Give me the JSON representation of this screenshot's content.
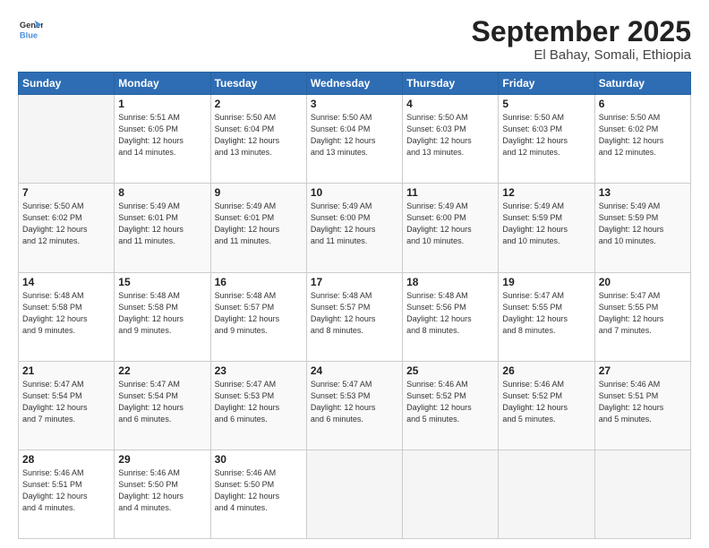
{
  "header": {
    "logo_line1": "General",
    "logo_line2": "Blue",
    "month": "September 2025",
    "location": "El Bahay, Somali, Ethiopia"
  },
  "weekdays": [
    "Sunday",
    "Monday",
    "Tuesday",
    "Wednesday",
    "Thursday",
    "Friday",
    "Saturday"
  ],
  "weeks": [
    [
      {
        "day": "",
        "info": ""
      },
      {
        "day": "1",
        "info": "Sunrise: 5:51 AM\nSunset: 6:05 PM\nDaylight: 12 hours\nand 14 minutes."
      },
      {
        "day": "2",
        "info": "Sunrise: 5:50 AM\nSunset: 6:04 PM\nDaylight: 12 hours\nand 13 minutes."
      },
      {
        "day": "3",
        "info": "Sunrise: 5:50 AM\nSunset: 6:04 PM\nDaylight: 12 hours\nand 13 minutes."
      },
      {
        "day": "4",
        "info": "Sunrise: 5:50 AM\nSunset: 6:03 PM\nDaylight: 12 hours\nand 13 minutes."
      },
      {
        "day": "5",
        "info": "Sunrise: 5:50 AM\nSunset: 6:03 PM\nDaylight: 12 hours\nand 12 minutes."
      },
      {
        "day": "6",
        "info": "Sunrise: 5:50 AM\nSunset: 6:02 PM\nDaylight: 12 hours\nand 12 minutes."
      }
    ],
    [
      {
        "day": "7",
        "info": "Sunrise: 5:50 AM\nSunset: 6:02 PM\nDaylight: 12 hours\nand 12 minutes."
      },
      {
        "day": "8",
        "info": "Sunrise: 5:49 AM\nSunset: 6:01 PM\nDaylight: 12 hours\nand 11 minutes."
      },
      {
        "day": "9",
        "info": "Sunrise: 5:49 AM\nSunset: 6:01 PM\nDaylight: 12 hours\nand 11 minutes."
      },
      {
        "day": "10",
        "info": "Sunrise: 5:49 AM\nSunset: 6:00 PM\nDaylight: 12 hours\nand 11 minutes."
      },
      {
        "day": "11",
        "info": "Sunrise: 5:49 AM\nSunset: 6:00 PM\nDaylight: 12 hours\nand 10 minutes."
      },
      {
        "day": "12",
        "info": "Sunrise: 5:49 AM\nSunset: 5:59 PM\nDaylight: 12 hours\nand 10 minutes."
      },
      {
        "day": "13",
        "info": "Sunrise: 5:49 AM\nSunset: 5:59 PM\nDaylight: 12 hours\nand 10 minutes."
      }
    ],
    [
      {
        "day": "14",
        "info": "Sunrise: 5:48 AM\nSunset: 5:58 PM\nDaylight: 12 hours\nand 9 minutes."
      },
      {
        "day": "15",
        "info": "Sunrise: 5:48 AM\nSunset: 5:58 PM\nDaylight: 12 hours\nand 9 minutes."
      },
      {
        "day": "16",
        "info": "Sunrise: 5:48 AM\nSunset: 5:57 PM\nDaylight: 12 hours\nand 9 minutes."
      },
      {
        "day": "17",
        "info": "Sunrise: 5:48 AM\nSunset: 5:57 PM\nDaylight: 12 hours\nand 8 minutes."
      },
      {
        "day": "18",
        "info": "Sunrise: 5:48 AM\nSunset: 5:56 PM\nDaylight: 12 hours\nand 8 minutes."
      },
      {
        "day": "19",
        "info": "Sunrise: 5:47 AM\nSunset: 5:55 PM\nDaylight: 12 hours\nand 8 minutes."
      },
      {
        "day": "20",
        "info": "Sunrise: 5:47 AM\nSunset: 5:55 PM\nDaylight: 12 hours\nand 7 minutes."
      }
    ],
    [
      {
        "day": "21",
        "info": "Sunrise: 5:47 AM\nSunset: 5:54 PM\nDaylight: 12 hours\nand 7 minutes."
      },
      {
        "day": "22",
        "info": "Sunrise: 5:47 AM\nSunset: 5:54 PM\nDaylight: 12 hours\nand 6 minutes."
      },
      {
        "day": "23",
        "info": "Sunrise: 5:47 AM\nSunset: 5:53 PM\nDaylight: 12 hours\nand 6 minutes."
      },
      {
        "day": "24",
        "info": "Sunrise: 5:47 AM\nSunset: 5:53 PM\nDaylight: 12 hours\nand 6 minutes."
      },
      {
        "day": "25",
        "info": "Sunrise: 5:46 AM\nSunset: 5:52 PM\nDaylight: 12 hours\nand 5 minutes."
      },
      {
        "day": "26",
        "info": "Sunrise: 5:46 AM\nSunset: 5:52 PM\nDaylight: 12 hours\nand 5 minutes."
      },
      {
        "day": "27",
        "info": "Sunrise: 5:46 AM\nSunset: 5:51 PM\nDaylight: 12 hours\nand 5 minutes."
      }
    ],
    [
      {
        "day": "28",
        "info": "Sunrise: 5:46 AM\nSunset: 5:51 PM\nDaylight: 12 hours\nand 4 minutes."
      },
      {
        "day": "29",
        "info": "Sunrise: 5:46 AM\nSunset: 5:50 PM\nDaylight: 12 hours\nand 4 minutes."
      },
      {
        "day": "30",
        "info": "Sunrise: 5:46 AM\nSunset: 5:50 PM\nDaylight: 12 hours\nand 4 minutes."
      },
      {
        "day": "",
        "info": ""
      },
      {
        "day": "",
        "info": ""
      },
      {
        "day": "",
        "info": ""
      },
      {
        "day": "",
        "info": ""
      }
    ]
  ]
}
